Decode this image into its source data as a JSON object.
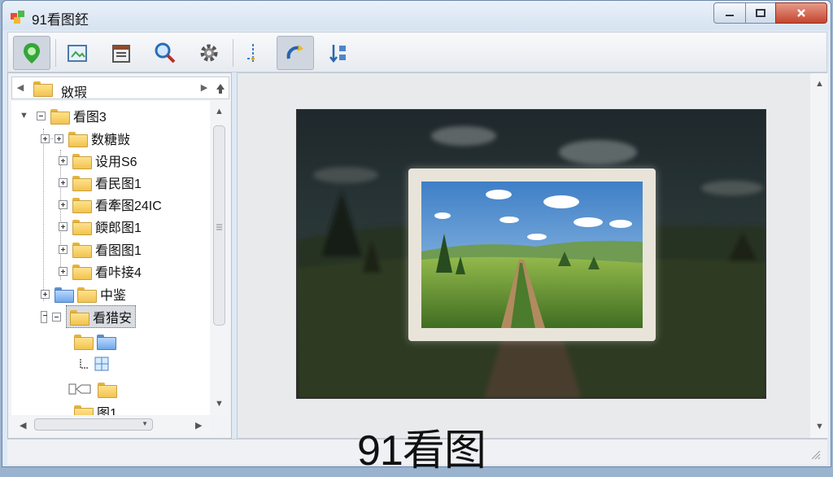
{
  "window": {
    "title": "91看图鉟"
  },
  "toolbar": {
    "tools": [
      "map-pin-icon",
      "image-edit-icon",
      "calendar-icon",
      "search-icon",
      "gear-icon",
      "connector-icon",
      "rotate-icon",
      "sort-icon"
    ],
    "active": [
      "map-pin-icon",
      "rotate-icon"
    ]
  },
  "address": {
    "label": "敓瑕"
  },
  "tree": {
    "items": [
      {
        "label": "看图3",
        "expander": "minus"
      },
      {
        "label": "数糖敱",
        "expander": "plus"
      },
      {
        "label": "设用S6",
        "expander": "plus"
      },
      {
        "label": "看民图1",
        "expander": "plus"
      },
      {
        "label": "看牽图24IC",
        "expander": "plus"
      },
      {
        "label": "餪郎图1",
        "expander": "plus"
      },
      {
        "label": "看图图1",
        "expander": "plus"
      },
      {
        "label": "看咔接4",
        "expander": "plus"
      },
      {
        "label": "中鉴",
        "expander": "plus"
      },
      {
        "label": "看猎安",
        "expander": "minus",
        "selected": true
      },
      {
        "label": "",
        "expander": "none"
      },
      {
        "label": "",
        "expander": "none"
      },
      {
        "label": "",
        "expander": "none"
      },
      {
        "label": "图1",
        "expander": "none"
      }
    ]
  },
  "viewer": {
    "watermark": "91看图"
  },
  "colors": {
    "accent": "#5b8fd1",
    "close": "#c4452f",
    "folder": "#f2c34f"
  }
}
